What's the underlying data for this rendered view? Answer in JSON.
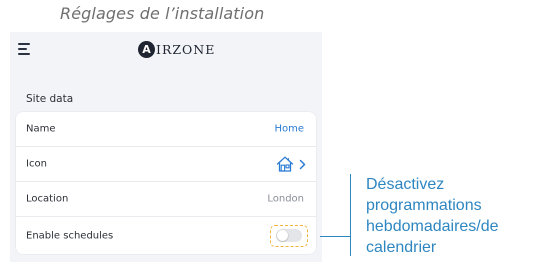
{
  "heading": "Réglages de l’installation",
  "app": {
    "logo": {
      "mark": "A",
      "text": "IRZONE"
    },
    "section_title": "Site data",
    "rows": [
      {
        "label": "Name",
        "value": "Home"
      },
      {
        "label": "Icon",
        "icon": "home-icon"
      },
      {
        "label": "Location",
        "value": "London"
      },
      {
        "label": "Enable schedules",
        "toggle": false
      }
    ]
  },
  "callout": {
    "lines": [
      "Désactivez",
      "programmations",
      "hebdomadaires/de",
      "calendrier"
    ]
  },
  "colors": {
    "link": "#2b7bd3",
    "callout": "#2e86c1",
    "highlight": "#f0b43a"
  }
}
